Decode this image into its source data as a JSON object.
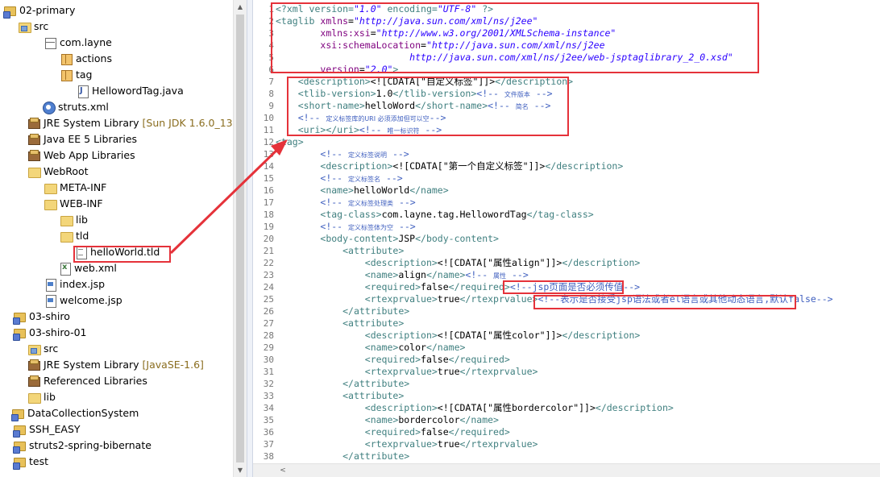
{
  "explorer": {
    "items": [
      {
        "label": "02-primary",
        "icon": "project-icon",
        "extra": ""
      },
      {
        "label": "src",
        "icon": "source-folder-icon",
        "extra": ""
      },
      {
        "label": "com.layne",
        "icon": "package-empty-icon",
        "extra": ""
      },
      {
        "label": "actions",
        "icon": "package-icon",
        "extra": ""
      },
      {
        "label": "tag",
        "icon": "package-icon",
        "extra": ""
      },
      {
        "label": "HellowordTag.java",
        "icon": "java-file-icon",
        "extra": ""
      },
      {
        "label": "struts.xml",
        "icon": "struts-config-icon",
        "extra": ""
      },
      {
        "label": "JRE System Library",
        "icon": "library-icon",
        "extra": "[Sun JDK 1.6.0_13]"
      },
      {
        "label": "Java EE 5 Libraries",
        "icon": "library-icon",
        "extra": ""
      },
      {
        "label": "Web App Libraries",
        "icon": "library-icon",
        "extra": ""
      },
      {
        "label": "WebRoot",
        "icon": "folder-icon",
        "extra": ""
      },
      {
        "label": "META-INF",
        "icon": "folder-icon",
        "extra": ""
      },
      {
        "label": "WEB-INF",
        "icon": "folder-icon",
        "extra": ""
      },
      {
        "label": "lib",
        "icon": "folder-icon",
        "extra": ""
      },
      {
        "label": "tld",
        "icon": "folder-icon",
        "extra": ""
      },
      {
        "label": "helloWorld.tld",
        "icon": "tld-file-icon",
        "extra": ""
      },
      {
        "label": "web.xml",
        "icon": "xml-file-icon",
        "extra": ""
      },
      {
        "label": "index.jsp",
        "icon": "jsp-file-icon",
        "extra": ""
      },
      {
        "label": "welcome.jsp",
        "icon": "jsp-file-icon",
        "extra": ""
      },
      {
        "label": "03-shiro",
        "icon": "project-icon",
        "extra": ""
      },
      {
        "label": "03-shiro-01",
        "icon": "project-icon",
        "extra": ""
      },
      {
        "label": "src",
        "icon": "source-folder-icon",
        "extra": ""
      },
      {
        "label": "JRE System Library",
        "icon": "library-icon",
        "extra": "[JavaSE-1.6]"
      },
      {
        "label": "Referenced Libraries",
        "icon": "library-icon",
        "extra": ""
      },
      {
        "label": "lib",
        "icon": "folder-icon",
        "extra": ""
      },
      {
        "label": "DataCollectionSystem",
        "icon": "project-icon",
        "extra": ""
      },
      {
        "label": "SSH_EASY",
        "icon": "project-icon",
        "extra": ""
      },
      {
        "label": "struts2-spring-bibernate",
        "icon": "project-icon",
        "extra": ""
      },
      {
        "label": "test",
        "icon": "project-icon",
        "extra": ""
      }
    ]
  },
  "editor": {
    "lines": [
      {
        "n": "1",
        "parts": [
          [
            "pi",
            "<?xml version="
          ],
          [
            "str",
            "\"1.0\""
          ],
          [
            "pi",
            " encoding="
          ],
          [
            "str",
            "\"UTF-8\""
          ],
          [
            "pi",
            " ?>"
          ]
        ]
      },
      {
        "n": "2",
        "parts": [
          [
            "tag",
            "<taglib "
          ],
          [
            "attr",
            "xmlns"
          ],
          [
            "txt",
            "="
          ],
          [
            "str",
            "\"http://java.sun.com/xml/ns/j2ee\""
          ]
        ]
      },
      {
        "n": "3",
        "parts": [
          [
            "txt",
            "        "
          ],
          [
            "attr",
            "xmlns:xsi"
          ],
          [
            "txt",
            "="
          ],
          [
            "str",
            "\"http://www.w3.org/2001/XMLSchema-instance\""
          ]
        ]
      },
      {
        "n": "4",
        "parts": [
          [
            "txt",
            "        "
          ],
          [
            "attr",
            "xsi:schemaLocation"
          ],
          [
            "txt",
            "="
          ],
          [
            "str",
            "\"http://java.sun.com/xml/ns/j2ee"
          ]
        ]
      },
      {
        "n": "5",
        "parts": [
          [
            "str",
            "                        http://java.sun.com/xml/ns/j2ee/web-jsptaglibrary_2_0.xsd\""
          ]
        ]
      },
      {
        "n": "6",
        "parts": [
          [
            "txt",
            "        "
          ],
          [
            "attr",
            "version"
          ],
          [
            "txt",
            "="
          ],
          [
            "str",
            "\"2.0\""
          ],
          [
            "tag",
            ">"
          ]
        ]
      },
      {
        "n": "7",
        "parts": [
          [
            "txt",
            "    "
          ],
          [
            "tag",
            "<description>"
          ],
          [
            "cdata",
            "<![CDATA[\"自定义标签\"]]>"
          ],
          [
            "tag",
            "</description>"
          ]
        ]
      },
      {
        "n": "8",
        "parts": [
          [
            "txt",
            "    "
          ],
          [
            "tag",
            "<tlib-version>"
          ],
          [
            "txt",
            "1.0"
          ],
          [
            "tag",
            "</tlib-version>"
          ],
          [
            "cmt",
            "<!-- "
          ],
          [
            "cmts",
            "文件版本"
          ],
          [
            "cmt",
            " -->"
          ]
        ]
      },
      {
        "n": "9",
        "parts": [
          [
            "txt",
            "    "
          ],
          [
            "tag",
            "<short-name>"
          ],
          [
            "txt",
            "helloWord"
          ],
          [
            "tag",
            "</short-name>"
          ],
          [
            "cmt",
            "<!-- "
          ],
          [
            "cmts",
            "简名"
          ],
          [
            "cmt",
            " -->"
          ]
        ]
      },
      {
        "n": "10",
        "parts": [
          [
            "txt",
            "    "
          ],
          [
            "cmt",
            "<!-- "
          ],
          [
            "cmts",
            "定义标签库的URI 必须添加但可以空"
          ],
          [
            "cmt",
            "-->"
          ]
        ]
      },
      {
        "n": "11",
        "parts": [
          [
            "txt",
            "    "
          ],
          [
            "tag",
            "<uri>"
          ],
          [
            "tag",
            "</uri>"
          ],
          [
            "cmt",
            "<!-- "
          ],
          [
            "cmts",
            "唯一标识符"
          ],
          [
            "cmt",
            " -->"
          ]
        ]
      },
      {
        "n": "12",
        "parts": [
          [
            "tag",
            "<tag>"
          ]
        ]
      },
      {
        "n": "13",
        "parts": [
          [
            "txt",
            "        "
          ],
          [
            "cmt",
            "<!-- "
          ],
          [
            "cmts",
            "定义标签说明"
          ],
          [
            "cmt",
            " -->"
          ]
        ]
      },
      {
        "n": "14",
        "parts": [
          [
            "txt",
            "        "
          ],
          [
            "tag",
            "<description>"
          ],
          [
            "cdata",
            "<![CDATA[\"第一个自定义标签\"]]>"
          ],
          [
            "tag",
            "</description>"
          ]
        ]
      },
      {
        "n": "15",
        "parts": [
          [
            "txt",
            "        "
          ],
          [
            "cmt",
            "<!-- "
          ],
          [
            "cmts",
            "定义标签名"
          ],
          [
            "cmt",
            " -->"
          ]
        ]
      },
      {
        "n": "16",
        "parts": [
          [
            "txt",
            "        "
          ],
          [
            "tag",
            "<name>"
          ],
          [
            "txt",
            "helloWorld"
          ],
          [
            "tag",
            "</name>"
          ]
        ]
      },
      {
        "n": "17",
        "parts": [
          [
            "txt",
            "        "
          ],
          [
            "cmt",
            "<!-- "
          ],
          [
            "cmts",
            "定义标签处理类"
          ],
          [
            "cmt",
            " -->"
          ]
        ]
      },
      {
        "n": "18",
        "parts": [
          [
            "txt",
            "        "
          ],
          [
            "tag",
            "<tag-class>"
          ],
          [
            "txt",
            "com.layne.tag.HellowordTag"
          ],
          [
            "tag",
            "</tag-class>"
          ]
        ]
      },
      {
        "n": "19",
        "parts": [
          [
            "txt",
            "        "
          ],
          [
            "cmt",
            "<!-- "
          ],
          [
            "cmts",
            "定义标签体为空"
          ],
          [
            "cmt",
            " -->"
          ]
        ]
      },
      {
        "n": "20",
        "parts": [
          [
            "txt",
            "        "
          ],
          [
            "tag",
            "<body-content>"
          ],
          [
            "txt",
            "JSP"
          ],
          [
            "tag",
            "</body-content>"
          ]
        ]
      },
      {
        "n": "21",
        "parts": [
          [
            "txt",
            "            "
          ],
          [
            "tag",
            "<attribute>"
          ]
        ]
      },
      {
        "n": "22",
        "parts": [
          [
            "txt",
            "                "
          ],
          [
            "tag",
            "<description>"
          ],
          [
            "cdata",
            "<![CDATA[\"属性align\"]]>"
          ],
          [
            "tag",
            "</description>"
          ]
        ]
      },
      {
        "n": "23",
        "parts": [
          [
            "txt",
            "                "
          ],
          [
            "tag",
            "<name>"
          ],
          [
            "txt",
            "align"
          ],
          [
            "tag",
            "</name>"
          ],
          [
            "cmt",
            "<!-- "
          ],
          [
            "cmts",
            "属性"
          ],
          [
            "cmt",
            " -->"
          ]
        ]
      },
      {
        "n": "24",
        "parts": [
          [
            "txt",
            "                "
          ],
          [
            "tag",
            "<required>"
          ],
          [
            "txt",
            "false"
          ],
          [
            "tag",
            "</required>"
          ],
          [
            "cmt",
            "<!--jsp页面是否必须传值-->"
          ]
        ]
      },
      {
        "n": "25",
        "parts": [
          [
            "txt",
            "                "
          ],
          [
            "tag",
            "<rtexprvalue>"
          ],
          [
            "txt",
            "true"
          ],
          [
            "tag",
            "</rtexprvalue>"
          ],
          [
            "cmt",
            "<!--表示是否接受jsp语法或者el语言或其他动态语言,默认false-->"
          ]
        ]
      },
      {
        "n": "26",
        "parts": [
          [
            "txt",
            "            "
          ],
          [
            "tag",
            "</attribute>"
          ]
        ]
      },
      {
        "n": "27",
        "parts": [
          [
            "txt",
            "            "
          ],
          [
            "tag",
            "<attribute>"
          ]
        ]
      },
      {
        "n": "28",
        "parts": [
          [
            "txt",
            "                "
          ],
          [
            "tag",
            "<description>"
          ],
          [
            "cdata",
            "<![CDATA[\"属性color\"]]>"
          ],
          [
            "tag",
            "</description>"
          ]
        ]
      },
      {
        "n": "29",
        "parts": [
          [
            "txt",
            "                "
          ],
          [
            "tag",
            "<name>"
          ],
          [
            "txt",
            "color"
          ],
          [
            "tag",
            "</name>"
          ]
        ]
      },
      {
        "n": "30",
        "parts": [
          [
            "txt",
            "                "
          ],
          [
            "tag",
            "<required>"
          ],
          [
            "txt",
            "false"
          ],
          [
            "tag",
            "</required>"
          ]
        ]
      },
      {
        "n": "31",
        "parts": [
          [
            "txt",
            "                "
          ],
          [
            "tag",
            "<rtexprvalue>"
          ],
          [
            "txt",
            "true"
          ],
          [
            "tag",
            "</rtexprvalue>"
          ]
        ]
      },
      {
        "n": "32",
        "parts": [
          [
            "txt",
            "            "
          ],
          [
            "tag",
            "</attribute>"
          ]
        ]
      },
      {
        "n": "33",
        "parts": [
          [
            "txt",
            "            "
          ],
          [
            "tag",
            "<attribute>"
          ]
        ]
      },
      {
        "n": "34",
        "parts": [
          [
            "txt",
            "                "
          ],
          [
            "tag",
            "<description>"
          ],
          [
            "cdata",
            "<![CDATA[\"属性bordercolor\"]]>"
          ],
          [
            "tag",
            "</description>"
          ]
        ]
      },
      {
        "n": "35",
        "parts": [
          [
            "txt",
            "                "
          ],
          [
            "tag",
            "<name>"
          ],
          [
            "txt",
            "bordercolor"
          ],
          [
            "tag",
            "</name>"
          ]
        ]
      },
      {
        "n": "36",
        "parts": [
          [
            "txt",
            "                "
          ],
          [
            "tag",
            "<required>"
          ],
          [
            "txt",
            "false"
          ],
          [
            "tag",
            "</required>"
          ]
        ]
      },
      {
        "n": "37",
        "parts": [
          [
            "txt",
            "                "
          ],
          [
            "tag",
            "<rtexprvalue>"
          ],
          [
            "txt",
            "true"
          ],
          [
            "tag",
            "</rtexprvalue>"
          ]
        ]
      },
      {
        "n": "38",
        "parts": [
          [
            "txt",
            "            "
          ],
          [
            "tag",
            "</attribute>"
          ]
        ]
      }
    ]
  },
  "icons": {
    "scroll_up": "▲",
    "scroll_down": "▼",
    "scroll_left": "<"
  },
  "colors": {
    "annotation_red": "#e5323a",
    "xml_tag": "#3f7f7f",
    "xml_attr": "#7f007f",
    "xml_string": "#2a00ff",
    "xml_comment": "#3f5fbf"
  }
}
